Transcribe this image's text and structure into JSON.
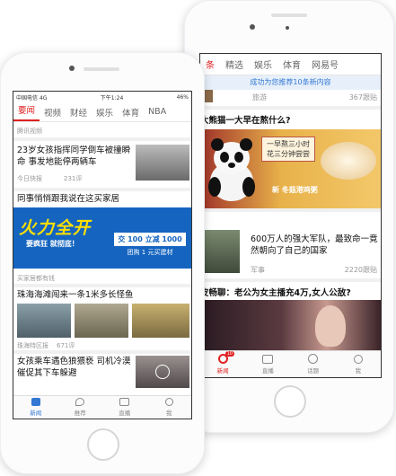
{
  "back_screen": {
    "tabs": [
      "条",
      "精选",
      "娱乐",
      "体育",
      "网易号"
    ],
    "active_tab": 0,
    "banner": "成功为您推荐10条新内容",
    "items": [
      {
        "tag": "旅游",
        "count": "367跟贴"
      },
      {
        "title": "大熊猫一大早在熬什么?"
      },
      {
        "ad_lines": [
          "一早熬三小时",
          "花三分钟尝尝"
        ],
        "ad_brand": "新",
        "ad_product": "冬菇港鸡粥"
      },
      {
        "title": "600万人的强大军队，最致命一竟然朝向了自己的国家",
        "tag": "军事",
        "count": "2220跟贴"
      },
      {
        "title": "皮畅聊：老公为女主播充4万,女人公敌?"
      }
    ],
    "bottom_nav": [
      {
        "label": "新闻",
        "badge": "10"
      },
      {
        "label": "直播"
      },
      {
        "label": "话题"
      },
      {
        "label": "我"
      }
    ]
  },
  "front_screen": {
    "status": {
      "carrier": "中国电信",
      "network": "4G",
      "time": "下午1:24",
      "battery": "46%"
    },
    "tabs": [
      "要闻",
      "视频",
      "财经",
      "娱乐",
      "体育",
      "NBA"
    ],
    "active_tab": 0,
    "items": [
      {
        "source": "腾讯视频"
      },
      {
        "title": "23岁女孩指挥同学倒车被撞瞬命 事发地能停两辆车",
        "source": "今日快报",
        "count": "231评"
      },
      {
        "title": "同事悄悄跟我说在这买家居"
      },
      {
        "ad_text": "火力全开",
        "ad_sub": "要疯狂 就彻底！",
        "ad_deal": "交 100 立减 1000",
        "ad_note": "团购 1 元买建材"
      },
      {
        "ad_label": "买家居都有钱"
      },
      {
        "title": "珠海海滩闯来一条1米多长怪鱼",
        "source": "珠海特区报",
        "count": "671评"
      },
      {
        "title": "女孩乘车遇色狼猥亵 司机冷漠催促其下车躲避"
      }
    ],
    "bottom_nav": [
      {
        "label": "新闻"
      },
      {
        "label": "推荐"
      },
      {
        "label": "直播"
      },
      {
        "label": "我"
      }
    ]
  },
  "colors": {
    "accent": "#e02020",
    "banner_text": "#3478d4",
    "ad_blue": "#1565c0",
    "ad_yellow": "#ffe000"
  }
}
